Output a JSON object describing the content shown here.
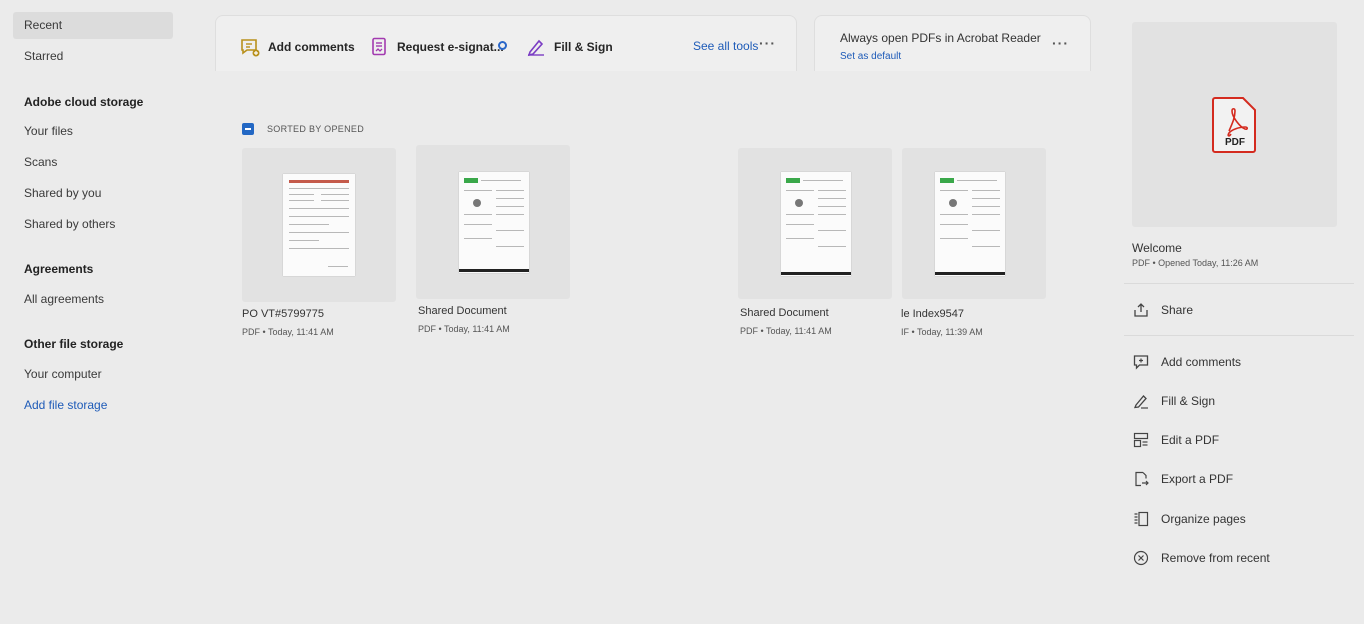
{
  "sidebar": {
    "recent": "Recent",
    "starred": "Starred",
    "cloud_heading": "Adobe cloud storage",
    "your_files": "Your files",
    "scans": "Scans",
    "shared_by_you": "Shared by you",
    "shared_by_others": "Shared by others",
    "agreements_heading": "Agreements",
    "all_agreements": "All agreements",
    "other_heading": "Other file storage",
    "your_computer": "Your computer",
    "add_file_storage": "Add file storage"
  },
  "toolbar": {
    "add_comments": "Add comments",
    "request_esign": "Request e-signat...",
    "fill_sign": "Fill & Sign",
    "see_all": "See all tools",
    "more": "···"
  },
  "default_banner": {
    "title": "Always open PDFs in Acrobat Reader",
    "link": "Set as default",
    "more": "···"
  },
  "list": {
    "sort_label": "SORTED BY OPENED",
    "files": [
      {
        "name": "PO VT#5799775",
        "meta": "PDF  •  Today, 11:41 AM"
      },
      {
        "name": "Shared Document",
        "meta": "PDF  •  Today, 11:41 AM"
      },
      {
        "name": "Shared Document",
        "meta": "PDF  •  Today, 11:41 AM"
      },
      {
        "name": "le Index9547",
        "meta": "IF  •  Today, 11:39 AM"
      }
    ]
  },
  "details": {
    "icon_label": "PDF",
    "name": "Welcome",
    "meta": "PDF  •  Opened Today, 11:26 AM",
    "share": "Share",
    "actions": {
      "add_comments": "Add comments",
      "fill_sign": "Fill & Sign",
      "edit_pdf": "Edit a PDF",
      "export_pdf": "Export a PDF",
      "organize": "Organize pages",
      "remove": "Remove from recent"
    }
  },
  "colors": {
    "accent": "#1e5bb8",
    "comment_icon": "#b8901c",
    "esign_icon": "#a23ab0",
    "fillsign_icon": "#7b3dc4",
    "pdf_red": "#d42b1f"
  }
}
